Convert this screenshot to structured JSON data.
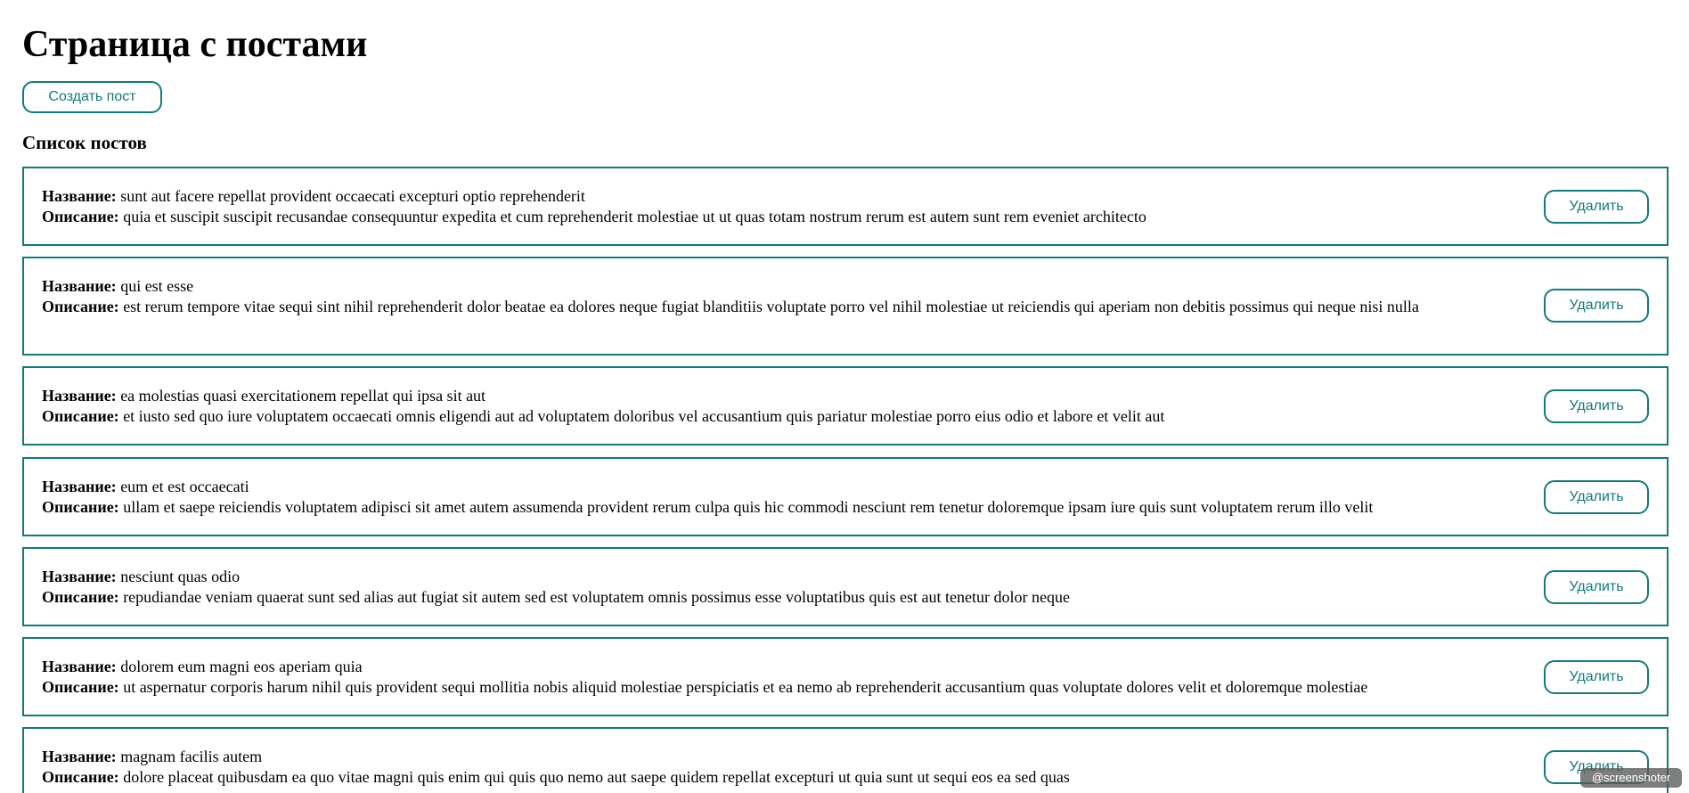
{
  "page_title": "Страница с постами",
  "create_button_label": "Создать пост",
  "list_title": "Список постов",
  "title_label": "Название:",
  "description_label": "Описание:",
  "delete_button_label": "Удалить",
  "accent_color": "#117a7a",
  "posts": [
    {
      "title": "sunt aut facere repellat provident occaecati excepturi optio reprehenderit",
      "description": "quia et suscipit suscipit recusandae consequuntur expedita et cum reprehenderit molestiae ut ut quas totam nostrum rerum est autem sunt rem eveniet architecto"
    },
    {
      "title": "qui est esse",
      "description": "est rerum tempore vitae sequi sint nihil reprehenderit dolor beatae ea dolores neque fugiat blanditiis voluptate porro vel nihil molestiae ut reiciendis qui aperiam non debitis possimus qui neque nisi nulla"
    },
    {
      "title": "ea molestias quasi exercitationem repellat qui ipsa sit aut",
      "description": "et iusto sed quo iure voluptatem occaecati omnis eligendi aut ad voluptatem doloribus vel accusantium quis pariatur molestiae porro eius odio et labore et velit aut"
    },
    {
      "title": "eum et est occaecati",
      "description": "ullam et saepe reiciendis voluptatem adipisci sit amet autem assumenda provident rerum culpa quis hic commodi nesciunt rem tenetur doloremque ipsam iure quis sunt voluptatem rerum illo velit"
    },
    {
      "title": "nesciunt quas odio",
      "description": "repudiandae veniam quaerat sunt sed alias aut fugiat sit autem sed est voluptatem omnis possimus esse voluptatibus quis est aut tenetur dolor neque"
    },
    {
      "title": "dolorem eum magni eos aperiam quia",
      "description": "ut aspernatur corporis harum nihil quis provident sequi mollitia nobis aliquid molestiae perspiciatis et ea nemo ab reprehenderit accusantium quas voluptate dolores velit et doloremque molestiae"
    },
    {
      "title": "magnam facilis autem",
      "description": "dolore placeat quibusdam ea quo vitae magni quis enim qui quis quo nemo aut saepe quidem repellat excepturi ut quia sunt ut sequi eos ea sed quas"
    }
  ],
  "watermark_text": "@screenshoter"
}
